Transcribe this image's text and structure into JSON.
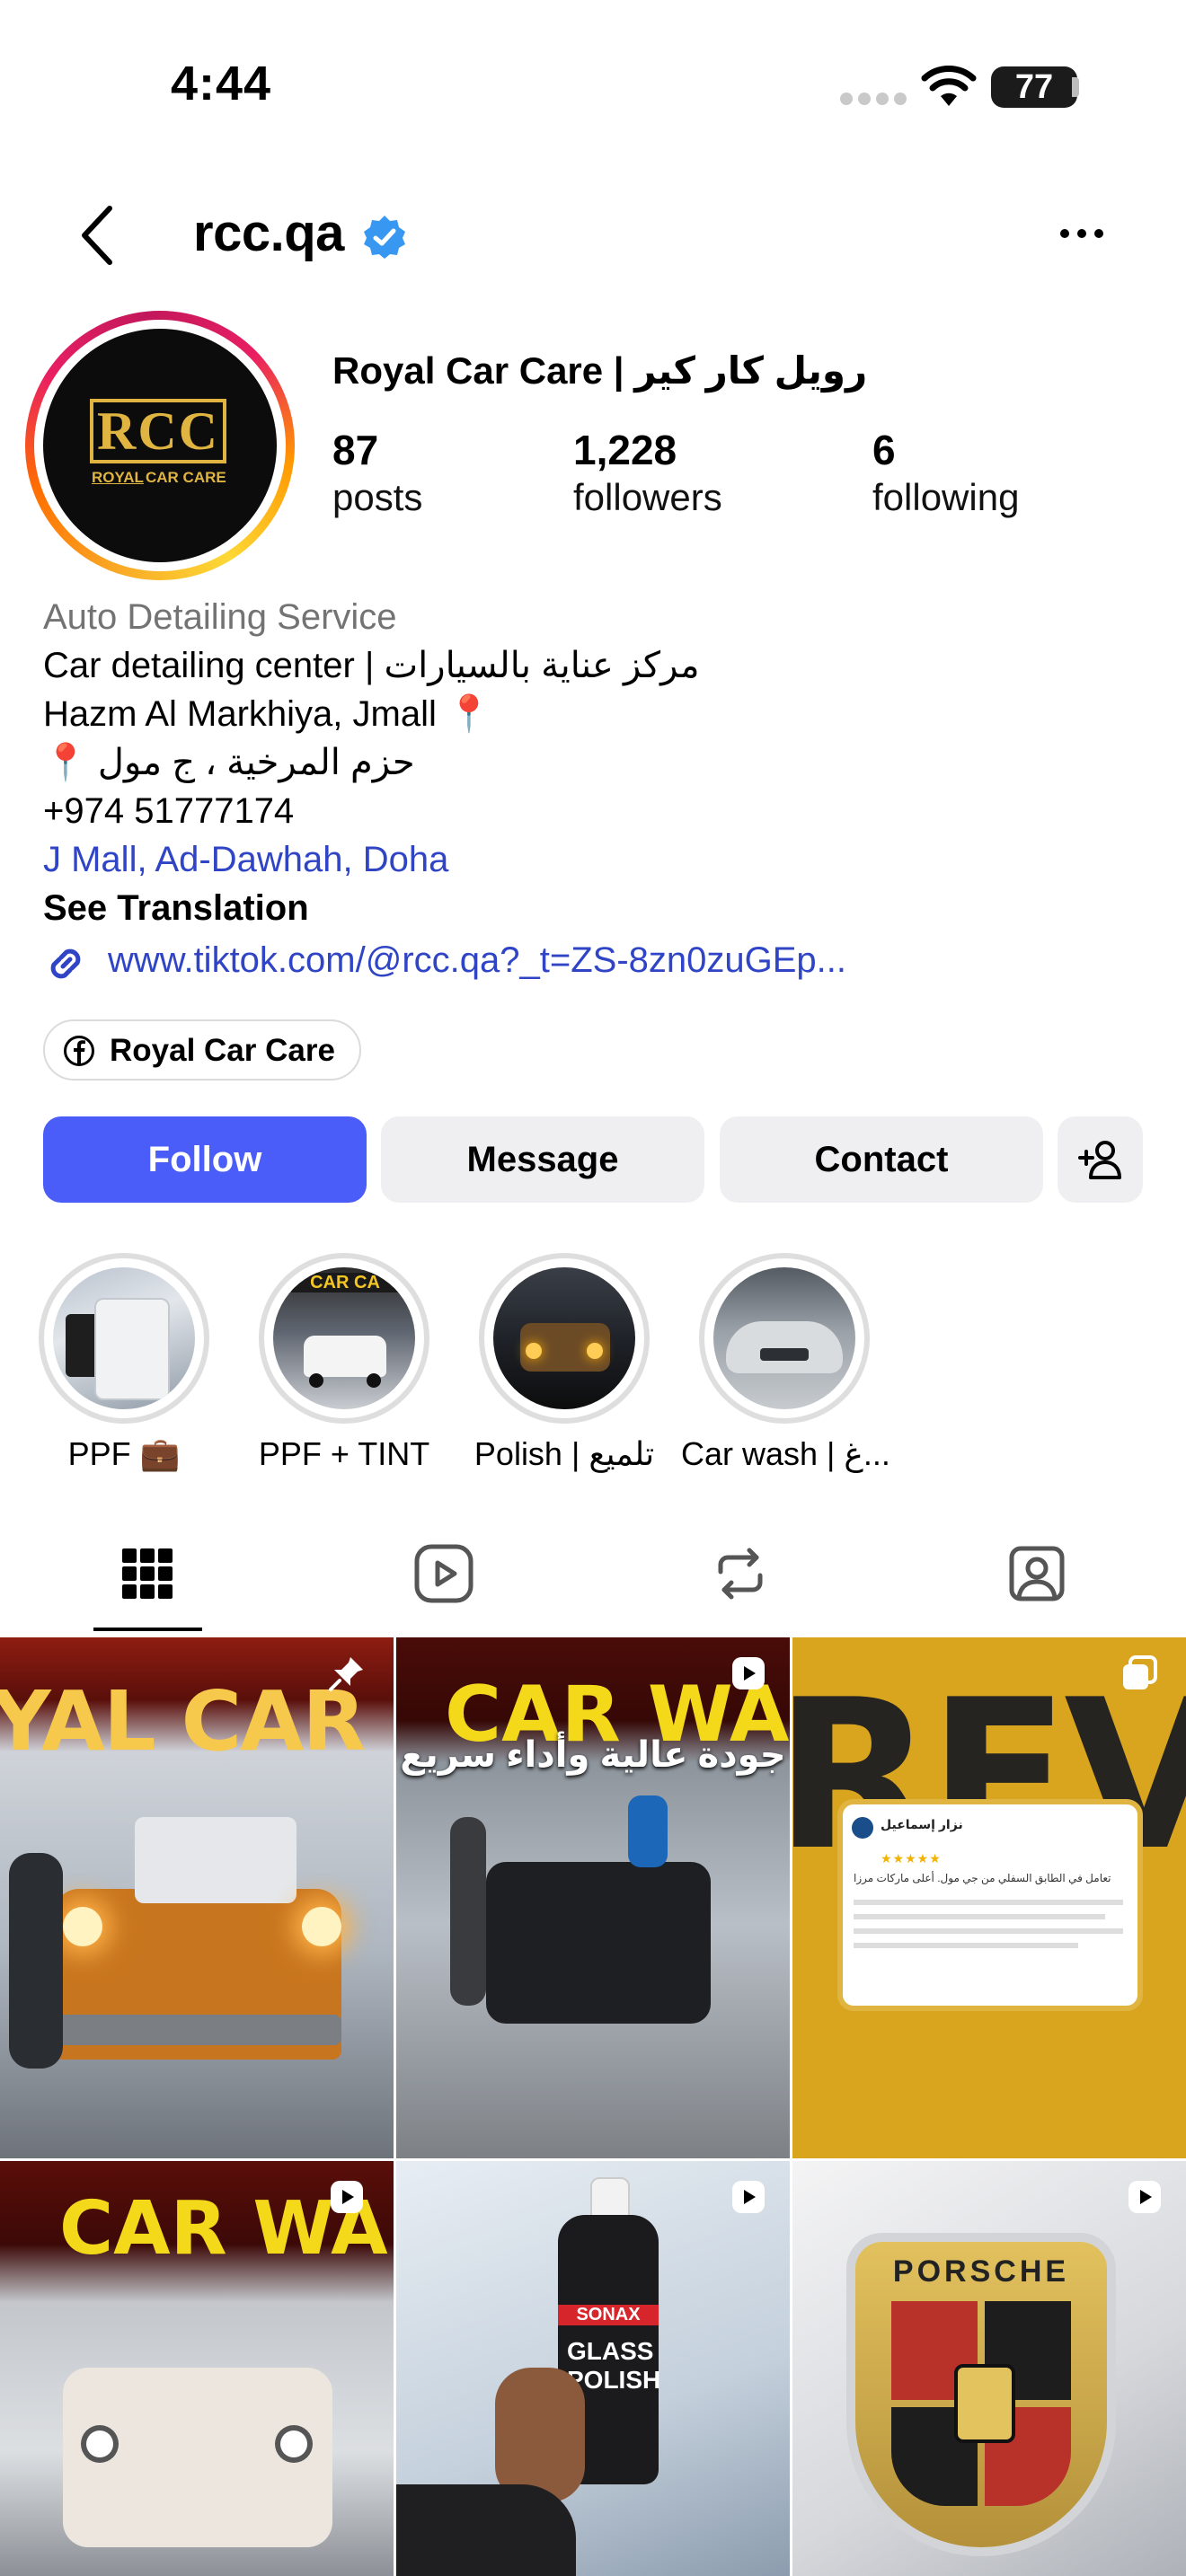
{
  "status_bar": {
    "time": "4:44",
    "battery": "77"
  },
  "header": {
    "handle": "rcc.qa"
  },
  "profile": {
    "logo_text": "RCC",
    "logo_sub_left": "ROYAL",
    "logo_sub_right": "CAR CARE",
    "display_name": "Royal Car Care | رويل كار كير",
    "stats": [
      {
        "value": "87",
        "label": "posts"
      },
      {
        "value": "1,228",
        "label": "followers"
      },
      {
        "value": "6",
        "label": "following"
      }
    ],
    "category": "Auto Detailing Service",
    "bio_lines": [
      "Car detailing center | مركز عناية بالسيارات",
      "Hazm Al Markhiya, Jmall 📍",
      "📍 حزم المرخية ، ج مول",
      "+974 51777174"
    ],
    "location": "J Mall, Ad-Dawhah, Doha",
    "see_translation": "See Translation",
    "website": "www.tiktok.com/@rcc.qa?_t=ZS-8zn0zuGEp...",
    "facebook_label": "Royal Car Care"
  },
  "actions": {
    "follow": "Follow",
    "message": "Message",
    "contact": "Contact"
  },
  "highlights": [
    {
      "label": "PPF 💼"
    },
    {
      "label": "PPF + TINT"
    },
    {
      "label": "Polish | تلميع"
    },
    {
      "label": "Car wash | غ..."
    }
  ],
  "posts": {
    "post1_banner": "YAL CAR C",
    "post2_banner": "CAR WA",
    "post2_caption": "جودة عالية وأداء سريع",
    "post3_banner": "REVIEW",
    "post3_review_name": "نزار إسماعيل",
    "post3_review_text": "تعامل في الطابق السفلي من جي مول. أعلى ماركات مرزا",
    "post4_banner": "CAR WA",
    "post5_product_brand": "SONAX",
    "post5_product_name": "GLASS POLISH",
    "post6_badge_text": "PORSCHE"
  },
  "colors": {
    "accent": "#4a5df9",
    "link": "#3045c6",
    "secondary_text": "#737373",
    "button_bg": "#efeff2",
    "logo_gold": "#e0b441"
  }
}
